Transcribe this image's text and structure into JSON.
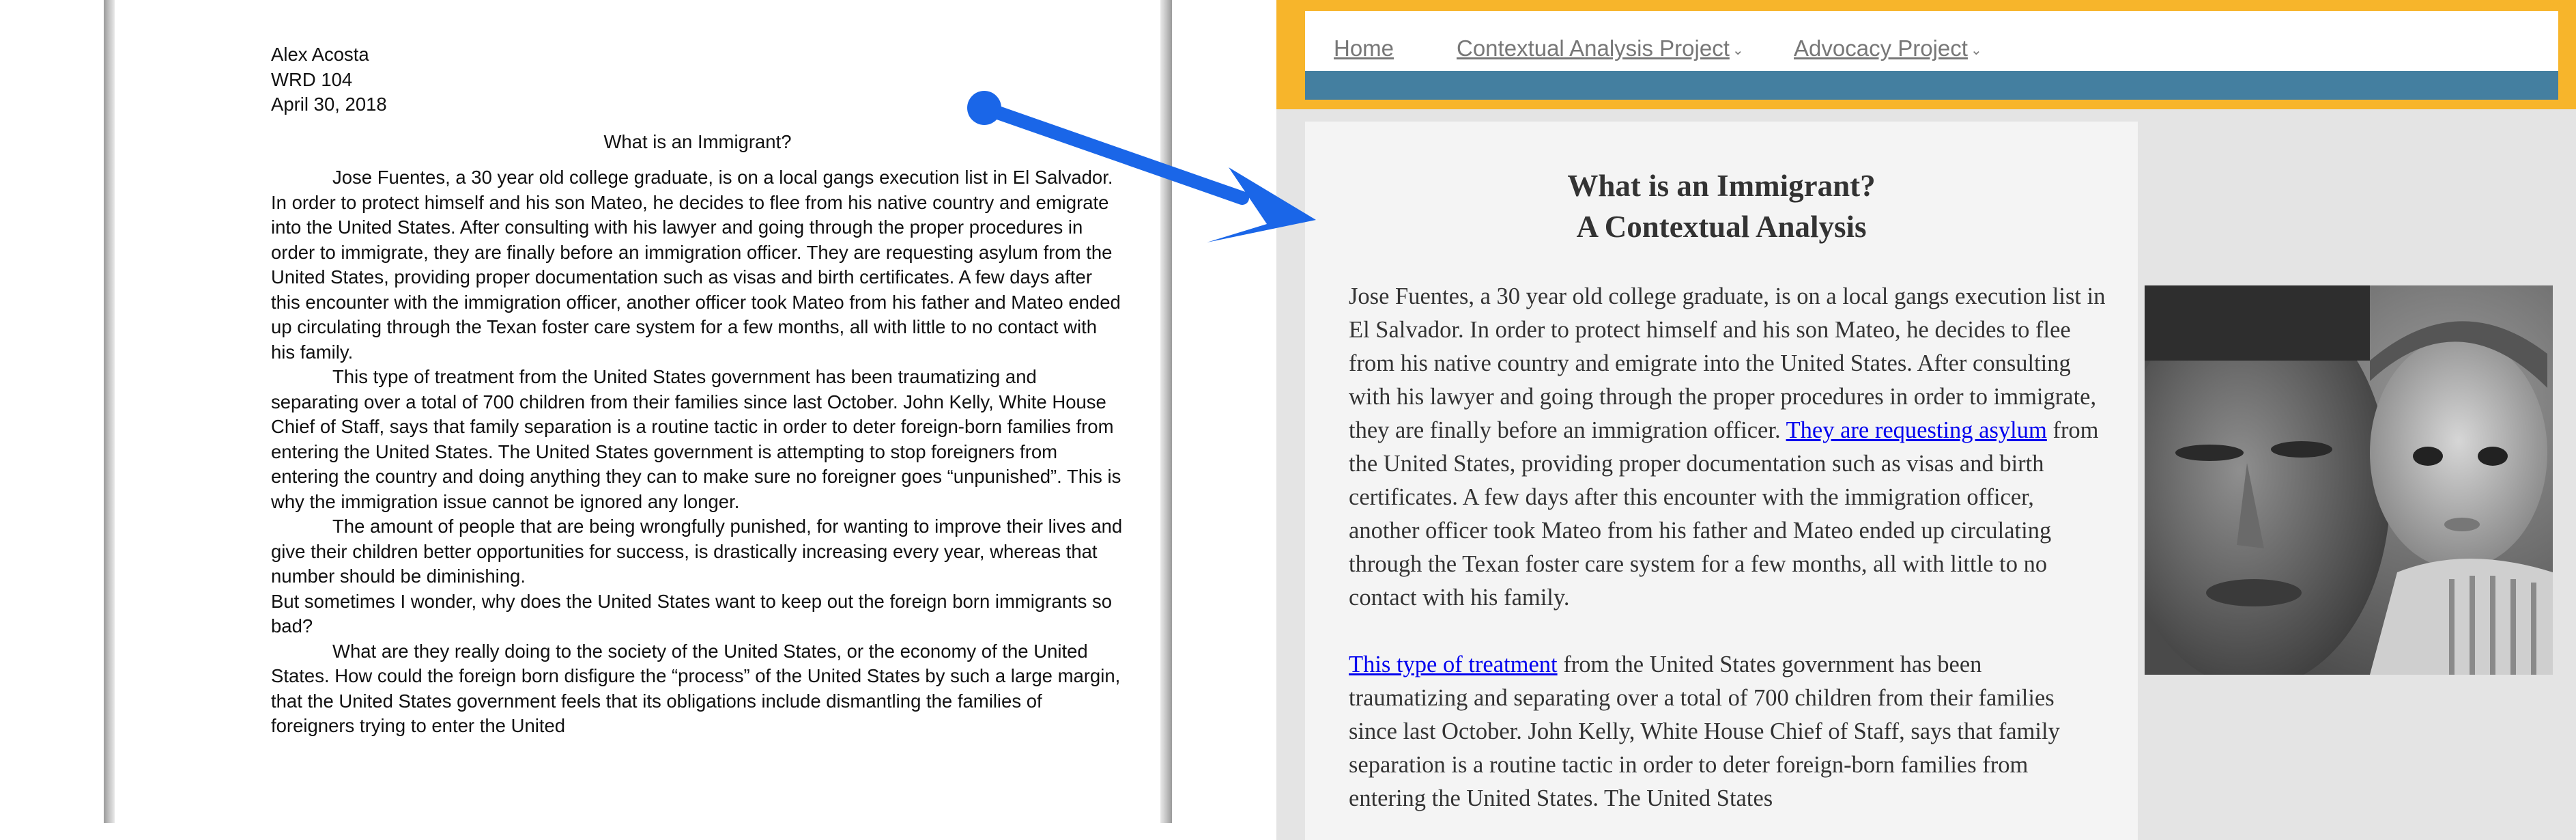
{
  "document": {
    "author": "Alex Acosta",
    "course": "WRD 104",
    "date": "April 30, 2018",
    "title": "What is an Immigrant?",
    "para1": "Jose Fuentes, a 30 year old college graduate, is on a local gangs execution list in El Salvador. In order to protect himself and his son Mateo, he decides to flee from his native country and emigrate into the United States. After consulting with his lawyer and going through the proper procedures in order to immigrate, they are finally before an immigration officer. They are requesting asylum from the United States, providing proper documentation such as visas and birth certificates. A few days after this encounter with the immigration officer, another officer took Mateo from his father and Mateo ended up circulating through the Texan foster care system for a few months, all with little to no contact with his family.",
    "para2": "This type of treatment from the United States government has been traumatizing and separating over a total of 700 children from their families since last October. John Kelly, White House Chief of Staff, says that family separation is a routine tactic in order to deter foreign-born families from entering the United States. The United States government is attempting to stop foreigners from entering the country and doing anything they can to make sure no foreigner goes “unpunished”. This is why the immigration issue cannot be ignored any longer.",
    "para3": "The amount of people that are being wrongfully punished, for wanting to improve their lives and give their children better opportunities for success, is drastically increasing every year, whereas that number should be diminishing.",
    "para4": "But sometimes I wonder, why does the United States want to keep out the foreign born immigrants so bad?",
    "para5": "What are they really doing to the society of the United States, or the economy of the United States. How could the foreign born disfigure the “process” of the United States by such a large margin, that the United States government feels that its obligations include dismantling the families of foreigners trying to enter the United"
  },
  "website": {
    "nav": {
      "home": "Home",
      "contextual": "Contextual Analysis Project",
      "advocacy": "Advocacy Project",
      "caret": "⌄"
    },
    "title_line1": "What is an Immigrant?",
    "title_line2": "A Contextual Analysis",
    "p1_before": "Jose Fuentes, a 30 year old college graduate, is on a local gangs execution list in El Salvador. In order to protect himself and his son Mateo, he decides to flee from his native country and emigrate into the United States. After consulting with his lawyer and going through the proper procedures in order to immigrate, they are finally before an immigration officer. ",
    "p1_link": "They are requesting asylum",
    "p1_after": " from the United States, providing proper documentation such as visas and birth certificates. A few days after this encounter with the immigration officer, another officer took Mateo from his father and Mateo ended up circulating through the Texan foster care system for a few months, all with little to no contact with his family.",
    "p2_link": "This type of treatment",
    "p2_after": " from the United States government has been traumatizing and separating over a total of 700 children from their families since last October. John Kelly, White House Chief of Staff, says that family separation is a routine tactic in order to deter foreign-born families from entering the United States. The United States"
  },
  "colors": {
    "header_orange": "#f7b52b",
    "nav_blue": "#447fa0",
    "arrow_blue": "#1a66e8",
    "link_blue": "#0000ee"
  },
  "icons": {
    "arrow": "arrow-icon",
    "photo": "father-and-son-photo"
  }
}
